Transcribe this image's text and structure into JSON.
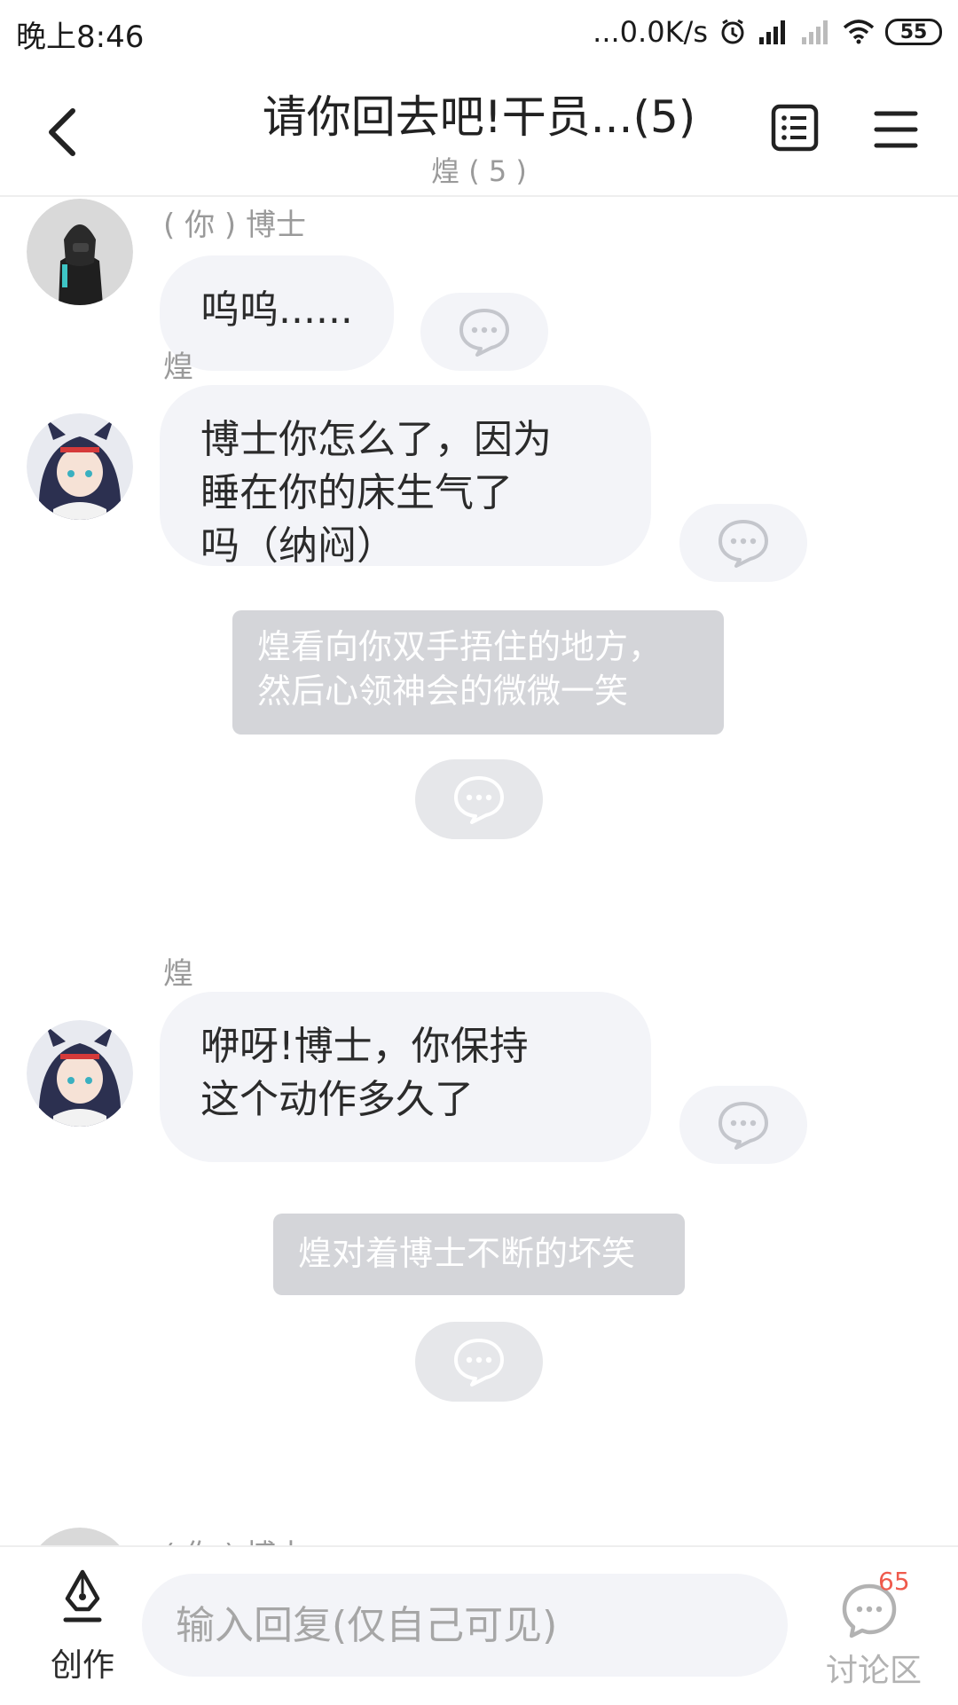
{
  "status_bar": {
    "time": "晚上8:46",
    "net_speed": "...0.0K/s",
    "battery": "55"
  },
  "header": {
    "title": "请你回去吧!干员...(5)",
    "subtitle": "煌 ( 5 )"
  },
  "messages": [
    {
      "sender": "( 你 ) 博士",
      "text": "呜呜......"
    },
    {
      "sender": "煌",
      "lines": [
        "博士你怎么了，因为",
        "睡在你的床生气了",
        "吗（纳闷）"
      ]
    },
    {
      "narration_lines": [
        "煌看向你双手捂住的地方，",
        "然后心领神会的微微一笑"
      ]
    },
    {
      "sender": "煌",
      "lines": [
        "咿呀!博士，你保持",
        "这个动作多久了"
      ]
    },
    {
      "narration_lines": [
        "煌对着博士不断的坏笑"
      ]
    },
    {
      "sender": "( 你 ) 博士"
    }
  ],
  "bottom_bar": {
    "create_label": "创作",
    "input_placeholder": "输入回复(仅自己可见)",
    "discuss_label": "讨论区",
    "discuss_badge": "65"
  },
  "colors": {
    "bubble_bg": "#f3f4f8",
    "narration_bg": "#d4d5d9",
    "badge": "#ef5a4c"
  },
  "icons": [
    "back-arrow-icon",
    "list-icon",
    "menu-icon",
    "comment-icon",
    "pen-nib-icon",
    "discussion-icon",
    "alarm-icon",
    "signal-icon",
    "wifi-icon"
  ]
}
